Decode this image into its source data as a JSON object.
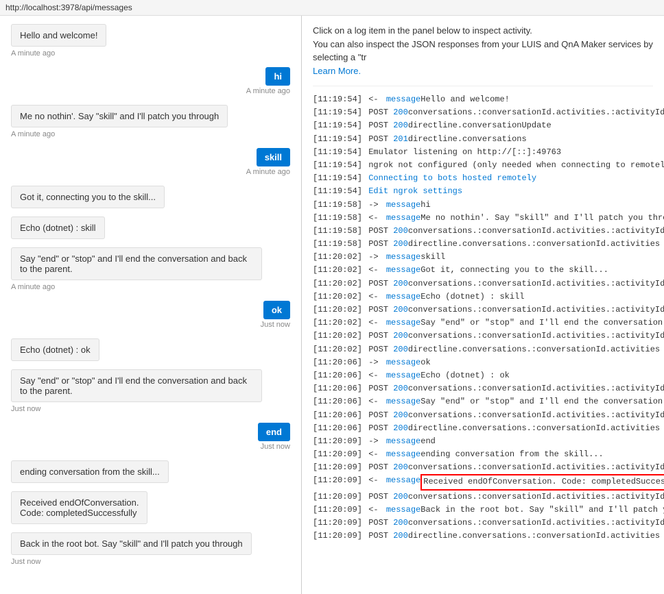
{
  "topbar": {
    "url": "http://localhost:3978/api/messages"
  },
  "info": {
    "line1": "Click on a log item in the panel below to inspect activity.",
    "line2": "You can also inspect the JSON responses from your LUIS and QnA Maker services by selecting a \"tr",
    "learn_more": "Learn More."
  },
  "chat": {
    "messages": [
      {
        "type": "bot",
        "text": "Hello and welcome!",
        "timestamp": "A minute ago"
      },
      {
        "type": "user",
        "text": "hi",
        "timestamp": "A minute ago"
      },
      {
        "type": "bot",
        "text": "Me no nothin'. Say \"skill\" and I'll patch you through",
        "timestamp": "A minute ago"
      },
      {
        "type": "user",
        "text": "skill",
        "timestamp": "A minute ago"
      },
      {
        "type": "bot",
        "text": "Got it, connecting you to the skill...",
        "timestamp": null
      },
      {
        "type": "bot",
        "text": "Echo (dotnet) : skill",
        "timestamp": null
      },
      {
        "type": "bot",
        "text": "Say \"end\" or \"stop\" and I'll end the conversation and back to the parent.",
        "timestamp": "A minute ago"
      },
      {
        "type": "user",
        "text": "ok",
        "timestamp": "Just now"
      },
      {
        "type": "bot",
        "text": "Echo (dotnet) : ok",
        "timestamp": null
      },
      {
        "type": "bot",
        "text": "Say \"end\" or \"stop\" and I'll end the conversation and back to the parent.",
        "timestamp": "Just now"
      },
      {
        "type": "user",
        "text": "end",
        "timestamp": "Just now"
      },
      {
        "type": "bot",
        "text": "ending conversation from the skill...",
        "timestamp": null
      },
      {
        "type": "bot",
        "text": "Received endOfConversation.\nCode: completedSuccessfully",
        "timestamp": null
      },
      {
        "type": "bot",
        "text": "Back in the root bot. Say \"skill\" and I'll patch you through",
        "timestamp": "Just now"
      }
    ]
  },
  "logs": [
    {
      "time": "[11:19:54]",
      "arrow": "<-",
      "type": "message",
      "text": " Hello and welcome!",
      "highlighted": false
    },
    {
      "time": "[11:19:54]",
      "arrow": null,
      "type": "POST",
      "status": "200",
      "path": " conversations.:conversationId.activities.:activityId",
      "highlighted": false
    },
    {
      "time": "[11:19:54]",
      "arrow": null,
      "type": "POST",
      "status": "200",
      "path": " directline.conversationUpdate",
      "highlighted": false
    },
    {
      "time": "[11:19:54]",
      "arrow": null,
      "type": "POST",
      "status": "201",
      "path": " directline.conversations",
      "highlighted": false
    },
    {
      "time": "[11:19:54]",
      "arrow": null,
      "type": "plain",
      "text": " Emulator listening on http://[::]:49763",
      "highlighted": false
    },
    {
      "time": "[11:19:54]",
      "arrow": null,
      "type": "plain",
      "text": " ngrok not configured (only needed when connecting to remotely hoste",
      "highlighted": false
    },
    {
      "time": "[11:19:54]",
      "arrow": null,
      "type": "link",
      "text": " Connecting to bots hosted remotely",
      "highlighted": false
    },
    {
      "time": "[11:19:54]",
      "arrow": null,
      "type": "link",
      "text": " Edit ngrok settings",
      "highlighted": false
    },
    {
      "time": "[11:19:58]",
      "arrow": "->",
      "type": "message",
      "text": " hi",
      "highlighted": false
    },
    {
      "time": "[11:19:58]",
      "arrow": "<-",
      "type": "message",
      "text": " Me no nothin'. Say \"skill\" and I'll patch you thro...",
      "highlighted": false
    },
    {
      "time": "[11:19:58]",
      "arrow": null,
      "type": "POST",
      "status": "200",
      "path": " conversations.:conversationId.activities.:activityId",
      "highlighted": false
    },
    {
      "time": "[11:19:58]",
      "arrow": null,
      "type": "POST",
      "status": "200",
      "path": " directline.conversations.:conversationId.activities",
      "highlighted": false
    },
    {
      "time": "[11:20:02]",
      "arrow": "->",
      "type": "message",
      "text": " skill",
      "highlighted": false
    },
    {
      "time": "[11:20:02]",
      "arrow": "<-",
      "type": "message",
      "text": " Got it, connecting you to the skill...",
      "highlighted": false
    },
    {
      "time": "[11:20:02]",
      "arrow": null,
      "type": "POST",
      "status": "200",
      "path": " conversations.:conversationId.activities.:activityId",
      "highlighted": false
    },
    {
      "time": "[11:20:02]",
      "arrow": "<-",
      "type": "message",
      "text": " Echo (dotnet) : skill",
      "highlighted": false
    },
    {
      "time": "[11:20:02]",
      "arrow": null,
      "type": "POST",
      "status": "200",
      "path": " conversations.:conversationId.activities.:activityId",
      "highlighted": false
    },
    {
      "time": "[11:20:02]",
      "arrow": "<-",
      "type": "message",
      "text": " Say \"end\" or \"stop\" and I'll end the conversation ...",
      "highlighted": false
    },
    {
      "time": "[11:20:02]",
      "arrow": null,
      "type": "POST",
      "status": "200",
      "path": " conversations.:conversationId.activities.:activityId",
      "highlighted": false
    },
    {
      "time": "[11:20:02]",
      "arrow": null,
      "type": "POST",
      "status": "200",
      "path": " directline.conversations.:conversationId.activities",
      "highlighted": false
    },
    {
      "time": "[11:20:06]",
      "arrow": "->",
      "type": "message",
      "text": " ok",
      "highlighted": false
    },
    {
      "time": "[11:20:06]",
      "arrow": "<-",
      "type": "message",
      "text": " Echo (dotnet) : ok",
      "highlighted": false
    },
    {
      "time": "[11:20:06]",
      "arrow": null,
      "type": "POST",
      "status": "200",
      "path": " conversations.:conversationId.activities.:activityId",
      "highlighted": false
    },
    {
      "time": "[11:20:06]",
      "arrow": "<-",
      "type": "message",
      "text": " Say \"end\" or \"stop\" and I'll end the conversation ...",
      "highlighted": false
    },
    {
      "time": "[11:20:06]",
      "arrow": null,
      "type": "POST",
      "status": "200",
      "path": " conversations.:conversationId.activities.:activityId",
      "highlighted": false
    },
    {
      "time": "[11:20:06]",
      "arrow": null,
      "type": "POST",
      "status": "200",
      "path": " directline.conversations.:conversationId.activities",
      "highlighted": false
    },
    {
      "time": "[11:20:09]",
      "arrow": "->",
      "type": "message",
      "text": " end",
      "highlighted": false
    },
    {
      "time": "[11:20:09]",
      "arrow": "<-",
      "type": "message",
      "text": " ending conversation from the skill...",
      "highlighted": false
    },
    {
      "time": "[11:20:09]",
      "arrow": null,
      "type": "POST",
      "status": "200",
      "path": " conversations.:conversationId.activities.:activityId",
      "highlighted": false
    },
    {
      "time": "[11:20:09]",
      "arrow": "<-",
      "type": "message",
      "text": " Received endOfConversation. Code: completedSucces...",
      "highlighted": true
    },
    {
      "time": "[11:20:09]",
      "arrow": null,
      "type": "POST",
      "status": "200",
      "path": " conversations.:conversationId.activities.:activityId",
      "highlighted": false
    },
    {
      "time": "[11:20:09]",
      "arrow": "<-",
      "type": "message",
      "text": " Back in the root bot. Say \"skill\" and I'll patch y...",
      "highlighted": false
    },
    {
      "time": "[11:20:09]",
      "arrow": null,
      "type": "POST",
      "status": "200",
      "path": " conversations.:conversationId.activities.:activityId",
      "highlighted": false
    },
    {
      "time": "[11:20:09]",
      "arrow": null,
      "type": "POST",
      "status": "200",
      "path": " directline.conversations.:conversationId.activities",
      "highlighted": false
    }
  ]
}
